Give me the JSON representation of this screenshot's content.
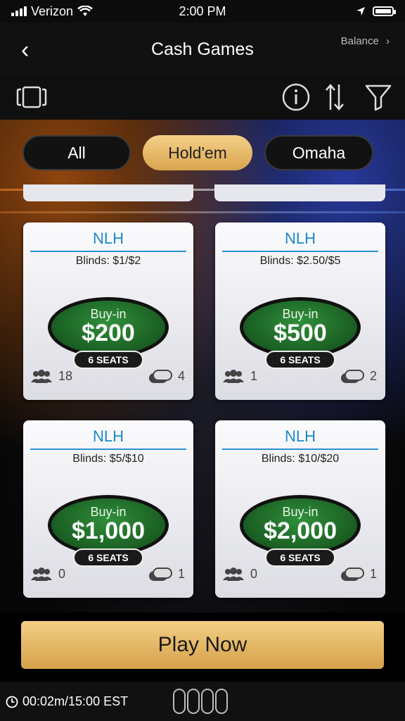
{
  "status_bar": {
    "carrier": "Verizon",
    "time": "2:00 PM"
  },
  "header": {
    "title": "Cash Games",
    "balance_label": "Balance",
    "balance_chevron": "›",
    "back_icon": "‹"
  },
  "toolbar": {
    "icons": [
      "cards-icon",
      "info-icon",
      "sort-icon",
      "filter-icon"
    ]
  },
  "tabs": [
    {
      "label": "All",
      "active": false
    },
    {
      "label": "Hold'em",
      "active": true
    },
    {
      "label": "Omaha",
      "active": false
    }
  ],
  "cards": [
    {
      "game": "NLH",
      "blinds": "Blinds: $1/$2",
      "buyin_label": "Buy-in",
      "buyin": "$200",
      "seats": "6 SEATS",
      "players": "18",
      "tables": "4"
    },
    {
      "game": "NLH",
      "blinds": "Blinds: $2.50/$5",
      "buyin_label": "Buy-in",
      "buyin": "$500",
      "seats": "6 SEATS",
      "players": "1",
      "tables": "2"
    },
    {
      "game": "NLH",
      "blinds": "Blinds: $5/$10",
      "buyin_label": "Buy-in",
      "buyin": "$1,000",
      "seats": "6 SEATS",
      "players": "0",
      "tables": "1"
    },
    {
      "game": "NLH",
      "blinds": "Blinds: $10/$20",
      "buyin_label": "Buy-in",
      "buyin": "$2,000",
      "seats": "6 SEATS",
      "players": "0",
      "tables": "1"
    }
  ],
  "play_now": {
    "label": "Play Now"
  },
  "footer": {
    "timer": "00:02m/15:00 EST"
  },
  "colors": {
    "accent_gold": "#e2b465",
    "game_blue": "#1a8ac8",
    "felt_green": "#1f6b27"
  }
}
